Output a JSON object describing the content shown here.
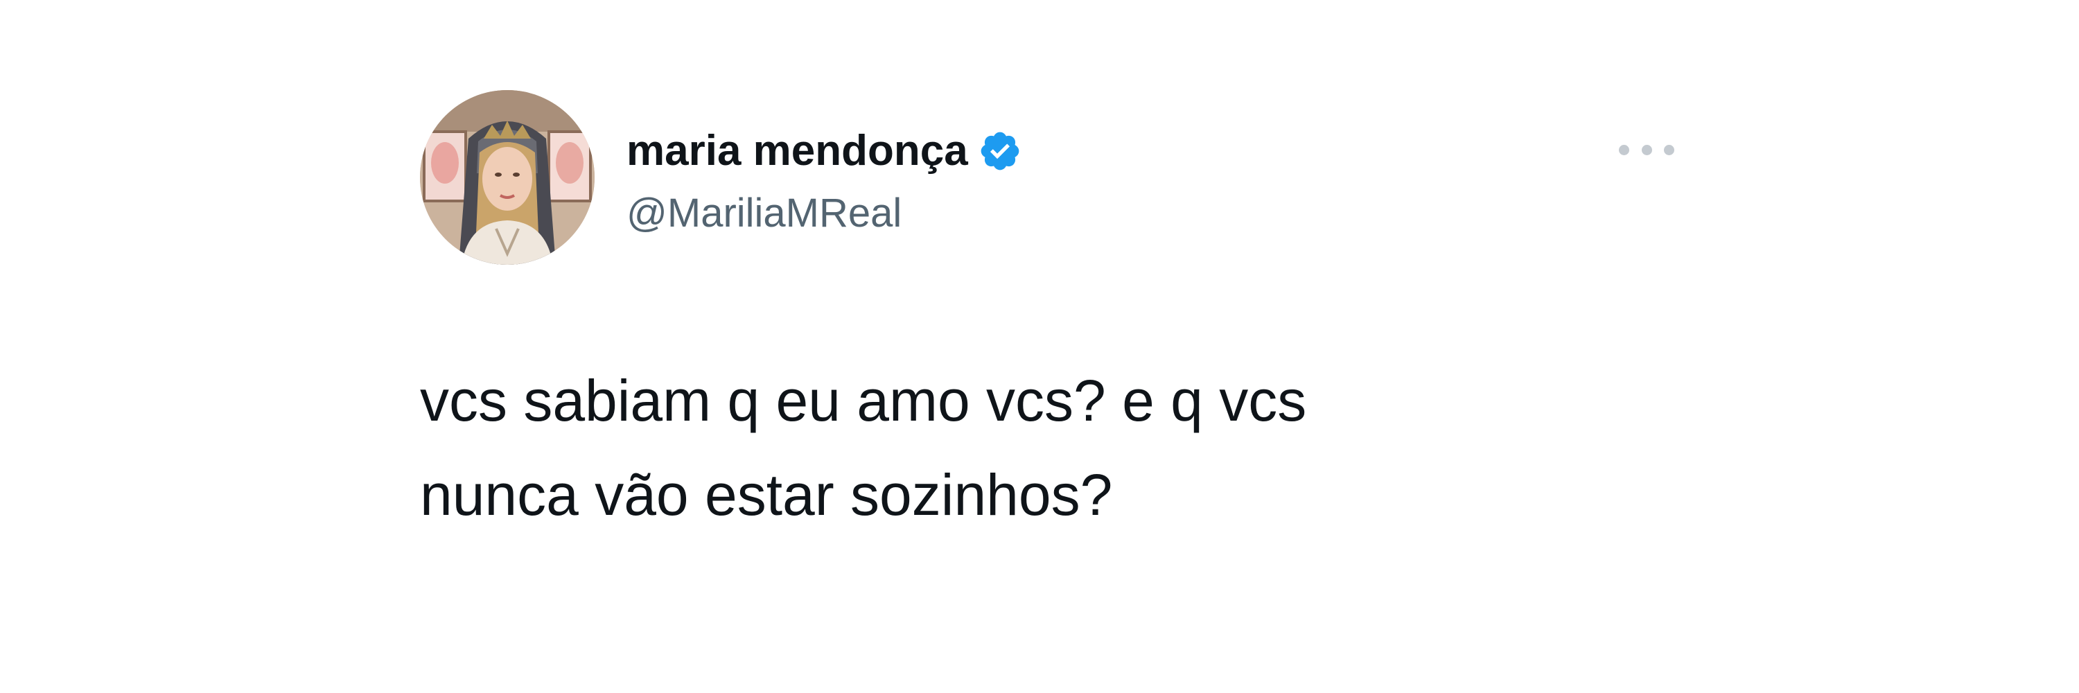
{
  "author": {
    "display_name": "maria mendonça",
    "handle": "@MariliaMReal",
    "verified": true
  },
  "tweet": {
    "lines": [
      "vcs sabiam q eu amo vcs? e q vcs",
      "nunca vão estar sozinhos?"
    ]
  },
  "icons": {
    "verified": "verified-badge-icon",
    "more": "more-options-icon"
  },
  "colors": {
    "verified_badge": "#1d9bf0",
    "name_text": "#0f1419",
    "handle_text": "#536471",
    "more_dots": "#c4cad0"
  }
}
